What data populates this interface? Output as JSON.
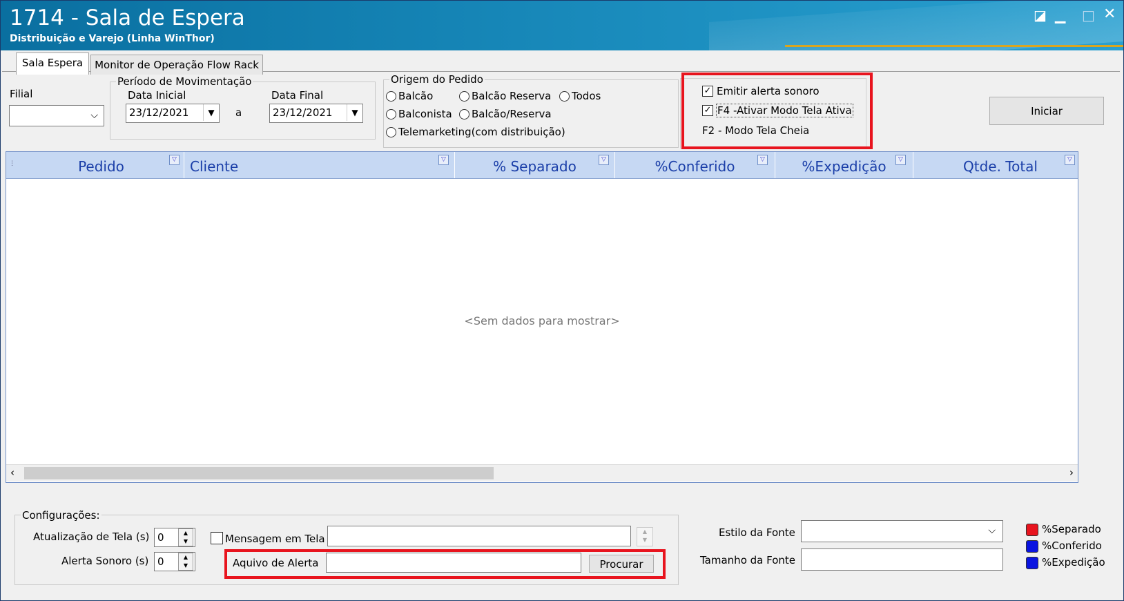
{
  "window": {
    "title": "1714 - Sala de Espera",
    "subtitle": "Distribuição e Varejo (Linha WinThor)"
  },
  "tabs": [
    {
      "label": "Sala Espera",
      "active": true
    },
    {
      "label": "Monitor de Operação Flow Rack",
      "active": false
    }
  ],
  "filters": {
    "filial_label": "Filial",
    "filial_value": "",
    "periodo_legend": "Período de Movimentação",
    "data_inicial_label": "Data Inicial",
    "data_inicial_value": "23/12/2021",
    "between_label": "a",
    "data_final_label": "Data Final",
    "data_final_value": "23/12/2021"
  },
  "origem": {
    "legend": "Origem do Pedido",
    "options": [
      "Balcão",
      "Balcão Reserva",
      "Todos",
      "Balconista",
      "Balcão/Reserva",
      "Telemarketing(com distribuição)"
    ]
  },
  "options": {
    "emitir_alerta_label": "Emitir alerta sonoro",
    "emitir_alerta_checked": true,
    "modo_tela_ativa_label": "F4 -Ativar Modo Tela Ativa",
    "modo_tela_ativa_checked": true,
    "modo_tela_cheia_label": "F2 - Modo Tela Cheia"
  },
  "iniciar_label": "Iniciar",
  "grid": {
    "columns": [
      "Pedido",
      "Cliente",
      "% Separado",
      "%Conferido",
      "%Expedição",
      "Qtde. Total"
    ],
    "empty_text": "<Sem dados para mostrar>"
  },
  "config": {
    "legend": "Configurações:",
    "atualizacao_label": "Atualização de Tela (s)",
    "atualizacao_value": "0",
    "alerta_sonoro_label": "Alerta Sonoro (s)",
    "alerta_sonoro_value": "0",
    "mensagem_label": "Mensagem em Tela",
    "mensagem_value": "",
    "arquivo_label": "Aquivo de Alerta",
    "arquivo_value": "",
    "procurar_label": "Procurar"
  },
  "fonte": {
    "estilo_label": "Estilo da Fonte",
    "estilo_value": "",
    "tamanho_label": "Tamanho da Fonte",
    "tamanho_value": ""
  },
  "legend_colors": [
    {
      "label": "%Separado",
      "color": "#e8141e"
    },
    {
      "label": "%Conferido",
      "color": "#0a14e0"
    },
    {
      "label": "%Expedição",
      "color": "#0a14e0"
    }
  ],
  "icons": {
    "restore": "restore-icon",
    "minimize": "minimize-icon",
    "maximize": "maximize-icon",
    "close": "close-icon"
  }
}
